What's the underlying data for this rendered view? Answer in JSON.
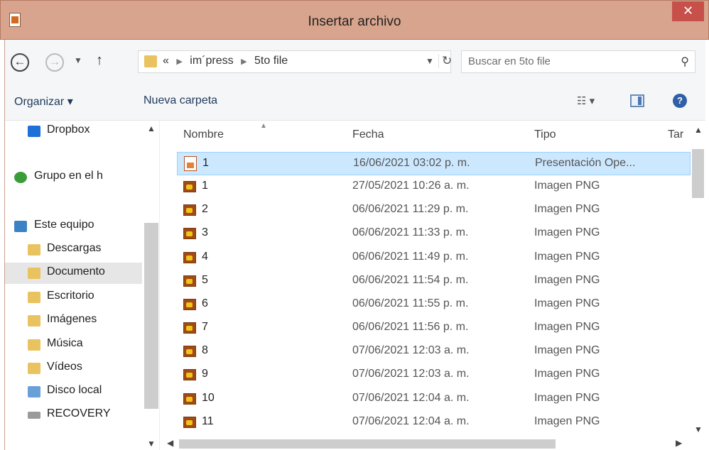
{
  "window": {
    "title": "Insertar archivo",
    "close_glyph": "✕"
  },
  "nav": {
    "back_glyph": "←",
    "forward_glyph": "→",
    "up_glyph": "↑",
    "address": {
      "prefix": "«",
      "crumbs": [
        "im´press",
        "5to file"
      ]
    },
    "search_placeholder": "Buscar en 5to file"
  },
  "toolbar": {
    "organize_label": "Organizar ▾",
    "new_folder_label": "Nueva carpeta"
  },
  "sidebar": {
    "items": [
      {
        "label": "Dropbox",
        "icon": "dropbox-icon",
        "color": "#1f6fd8"
      },
      {
        "label": "Grupo en el h",
        "icon": "homegroup-icon",
        "color": "#3a9d3a"
      },
      {
        "label": "Este equipo",
        "icon": "computer-icon",
        "color": "#3b82c4"
      },
      {
        "label": "Descargas",
        "icon": "downloads-folder-icon",
        "color": "#e9c35f"
      },
      {
        "label": "Documento",
        "icon": "documents-folder-icon",
        "color": "#e9c35f"
      },
      {
        "label": "Escritorio",
        "icon": "desktop-folder-icon",
        "color": "#e9c35f"
      },
      {
        "label": "Imágenes",
        "icon": "pictures-folder-icon",
        "color": "#e9c35f"
      },
      {
        "label": "Música",
        "icon": "music-folder-icon",
        "color": "#e9c35f"
      },
      {
        "label": "Vídeos",
        "icon": "videos-folder-icon",
        "color": "#e9c35f"
      },
      {
        "label": "Disco local",
        "icon": "local-disk-icon",
        "color": "#6aa0d8"
      },
      {
        "label": "RECOVERY",
        "icon": "drive-icon",
        "color": "#9a9a9a"
      }
    ]
  },
  "columns": {
    "name": "Nombre",
    "date": "Fecha",
    "type": "Tipo",
    "size": "Tar"
  },
  "files": [
    {
      "name": "1",
      "date": "16/06/2021 03:02 p. m.",
      "type": "Presentación Ope...",
      "icon": "odp-file-icon",
      "selected": true
    },
    {
      "name": "1",
      "date": "27/05/2021 10:26 a. m.",
      "type": "Imagen PNG",
      "icon": "png-file-icon"
    },
    {
      "name": "2",
      "date": "06/06/2021 11:29 p. m.",
      "type": "Imagen PNG",
      "icon": "png-file-icon"
    },
    {
      "name": "3",
      "date": "06/06/2021 11:33 p. m.",
      "type": "Imagen PNG",
      "icon": "png-file-icon"
    },
    {
      "name": "4",
      "date": "06/06/2021 11:49 p. m.",
      "type": "Imagen PNG",
      "icon": "png-file-icon"
    },
    {
      "name": "5",
      "date": "06/06/2021 11:54 p. m.",
      "type": "Imagen PNG",
      "icon": "png-file-icon"
    },
    {
      "name": "6",
      "date": "06/06/2021 11:55 p. m.",
      "type": "Imagen PNG",
      "icon": "png-file-icon"
    },
    {
      "name": "7",
      "date": "06/06/2021 11:56 p. m.",
      "type": "Imagen PNG",
      "icon": "png-file-icon"
    },
    {
      "name": "8",
      "date": "07/06/2021 12:03 a. m.",
      "type": "Imagen PNG",
      "icon": "png-file-icon"
    },
    {
      "name": "9",
      "date": "07/06/2021 12:03 a. m.",
      "type": "Imagen PNG",
      "icon": "png-file-icon"
    },
    {
      "name": "10",
      "date": "07/06/2021 12:04 a. m.",
      "type": "Imagen PNG",
      "icon": "png-file-icon"
    },
    {
      "name": "11",
      "date": "07/06/2021 12:04 a. m.",
      "type": "Imagen PNG",
      "icon": "png-file-icon"
    }
  ]
}
